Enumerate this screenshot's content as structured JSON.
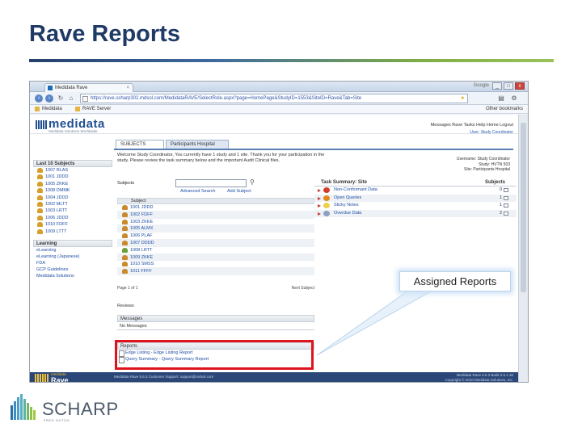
{
  "slide": {
    "title": "Rave Reports",
    "callout": "Assigned Reports",
    "brand_name": "SCHARP",
    "brand_sub": "FRED HUTCH"
  },
  "browser": {
    "tab_title": "Medidata Rave",
    "tab_close": "×",
    "search_engine": "Google",
    "address": "https://rave.scharp302.mdsol.com/MedidataRAVE/SelectRole.aspx?page=HomePage&StudyID=1553&SiteID=Rave&Tab=Site",
    "bookmarks": [
      "Medidata",
      "RAVE Server"
    ],
    "other_bookmarks": "Other bookmarks"
  },
  "app": {
    "logo": "medidata",
    "logo_sub": "Medidata Solutions Worldwide",
    "top_links": "Messages  Rave Tasks  Help  Home  Logout",
    "top_user": "User: Study Coordinator",
    "tabs": [
      "SUBJECTS",
      "Participants Hospital"
    ],
    "welcome": "Welcome Study Coordinator, You currently have 1 study and 1 site. Thank you for your participation in the study. Please review the task summary below and the important Audit Clinical files.",
    "right_info": [
      "Username: Study Coordinator",
      "Study: HVTN 503",
      "Site: Participants Hospital"
    ],
    "sidebar": {
      "subjects_header": "Last 10 Subjects",
      "subjects": [
        "1007 RLAS",
        "1001 JDDD",
        "1005 ZKKE",
        "1008 DMMK",
        "1004 JDDD",
        "1002 MLTT",
        "1003 LRTT",
        "1006 JDDD",
        "1010 FDFF",
        "1009 LTTT"
      ],
      "learning_header": "Learning",
      "learning": [
        "eLearning",
        "eLearning (Japanese)",
        "FDA",
        "GCP Guidelines",
        "Medidata Solutions"
      ]
    },
    "subject_search": {
      "label": "Subjects",
      "placeholder": "",
      "advanced": "Advanced Search",
      "add": "Add Subject"
    },
    "subject_list": {
      "header": "Subject",
      "rows": [
        "1001 JDDD",
        "1002 FDFF",
        "1003 ZKKE",
        "1005 ALMX",
        "1006 PLAF",
        "1007 DDDD",
        "1008 LRTT",
        "1009 ZKKE",
        "1010 SMSS",
        "1011 FFFF"
      ],
      "footer_left": "Page 1 of 1",
      "footer_right": "Next Subject"
    },
    "reviews_label": "Reviews",
    "messages": {
      "header": "Messages",
      "body": "No Messages"
    },
    "reports": {
      "header": "Reports",
      "items": [
        "Edge Listing - Edge Listing Report",
        "Query Summary - Query Summary Report"
      ]
    },
    "task_summary": {
      "header": "Task Summary: Site",
      "col": "Subjects",
      "rows": [
        {
          "label": "Non-Conformant Data",
          "count": "0",
          "color": "#d33d2e"
        },
        {
          "label": "Open Queries",
          "count": "1",
          "color": "#e08a1e"
        },
        {
          "label": "Sticky Notes",
          "count": "1",
          "color": "#f0d04a"
        },
        {
          "label": "Overdue Data",
          "count": "2",
          "color": "#8aa0bd"
        }
      ]
    },
    "footer": {
      "logo_small": "medidata",
      "logo_big": "Rave",
      "mid": "Medidata Rave 5.6.3  Customer Support: support@mdsol.com",
      "right": [
        "Medidata Rave  5.6.3  Build 3.6.1.30",
        "Copyright © 2010 Medidata Solutions, Inc."
      ]
    }
  },
  "colors": {
    "title": "#1f3a66",
    "highlight": "#e0141c",
    "brand_blue": "#1e4f91"
  }
}
